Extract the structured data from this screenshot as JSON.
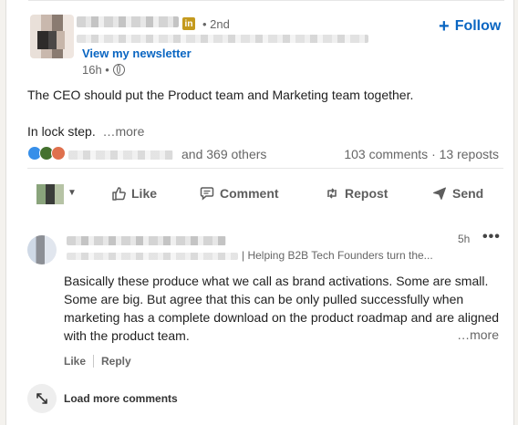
{
  "post": {
    "degree": "• 2nd",
    "newsletter_link": "View my newsletter",
    "time": "16h •",
    "follow_label": "Follow",
    "text_line1": "The CEO should put the Product team and Marketing team together.",
    "text_line2": "In lock step.",
    "more_label": "…more",
    "reactions_text": "and 369 others",
    "counts_text": "103 comments · 13 reposts"
  },
  "actions": {
    "like": "Like",
    "comment": "Comment",
    "repost": "Repost",
    "send": "Send"
  },
  "comment": {
    "time": "5h",
    "headline": "| Helping B2B Tech Founders turn the...",
    "text": "Basically these produce what we call as brand activations. Some are small. Some are big. But agree that this can be only pulled successfully when marketing has a complete download on the product roadmap and are aligned with the product team.",
    "more_label": "…more",
    "like": "Like",
    "reply": "Reply"
  },
  "load_more": "Load more comments",
  "colors": {
    "brand_blue": "#0a66c2",
    "muted": "#666666",
    "like_blue": "#378fe9",
    "celebrate_green": "#44712e",
    "love_red": "#df704d"
  }
}
